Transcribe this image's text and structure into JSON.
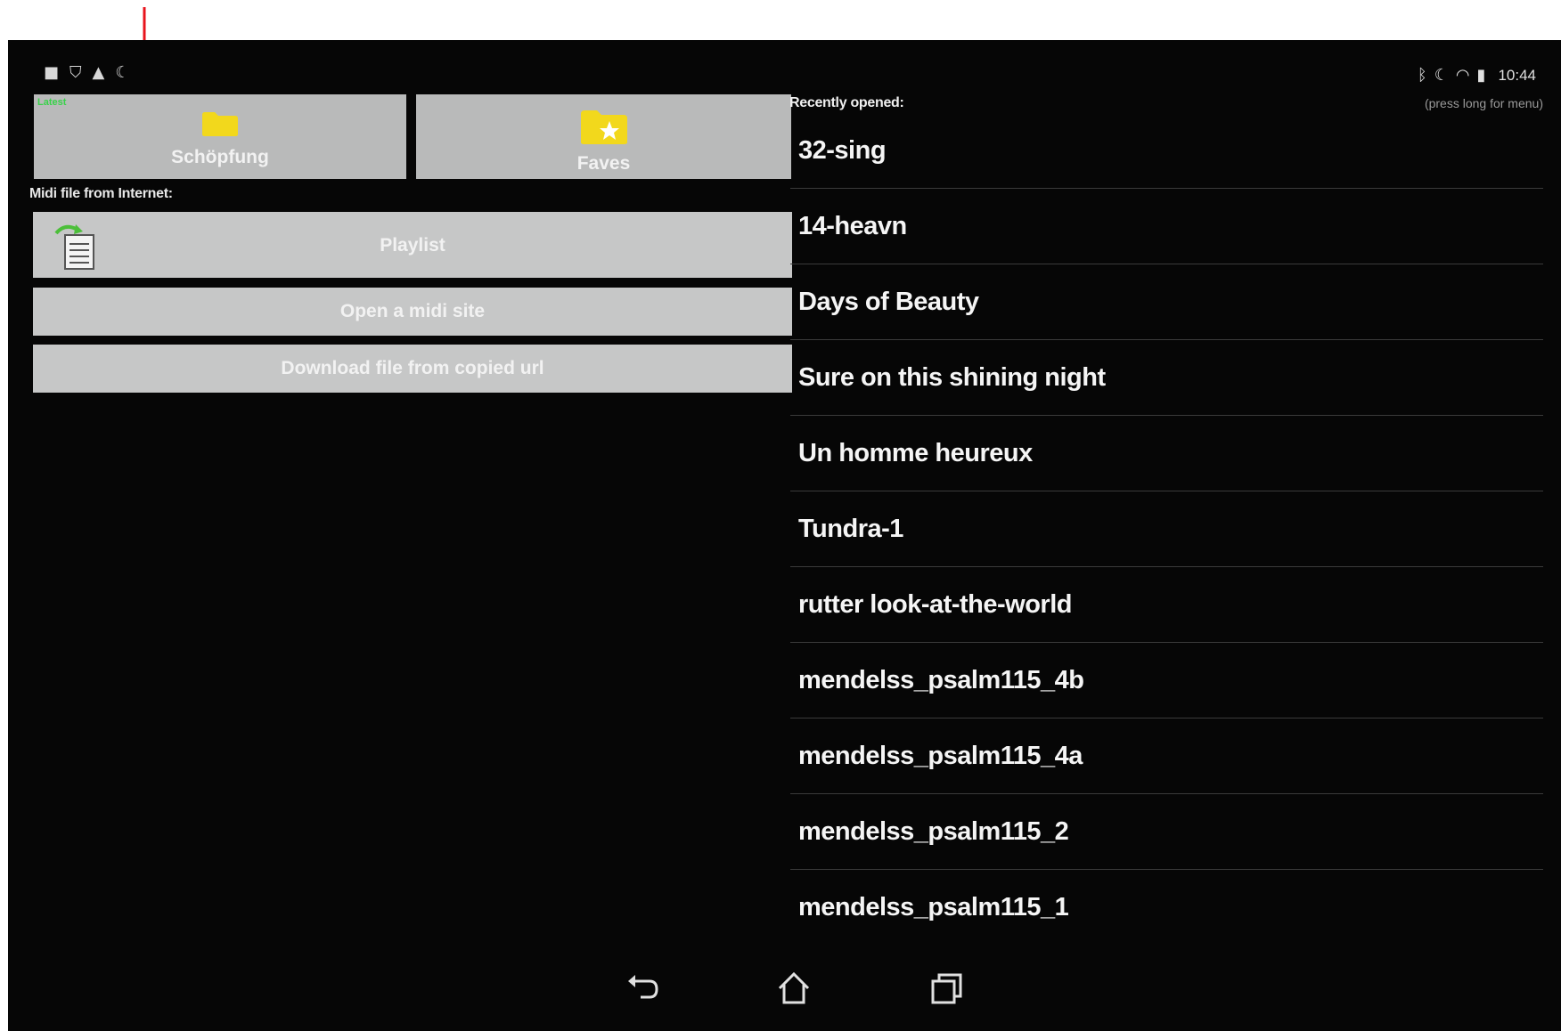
{
  "status_bar": {
    "left_icons": [
      "notification-icon",
      "shield-icon",
      "warning-icon",
      "moon-icon"
    ],
    "right_icons": [
      "bluetooth-icon",
      "moon-icon",
      "wifi-icon",
      "battery-icon"
    ],
    "time": "10:44"
  },
  "hint": "(press long for menu)",
  "folder_button": {
    "tag": "Latest",
    "label": "Schöpfung",
    "icon": "folder-icon"
  },
  "faves_button": {
    "label": "Faves",
    "icon": "folder-star-icon"
  },
  "internet_section_label": "Midi file from Internet:",
  "playlist_button": {
    "label": "Playlist",
    "icon": "playlist-icon"
  },
  "midi_site_button": {
    "label": "Open a midi site"
  },
  "download_button": {
    "label": "Download file from copied url"
  },
  "recent": {
    "title": "Recently opened:",
    "items": [
      "32-sing",
      "14-heavn",
      "Days of Beauty",
      "Sure on this shining night",
      "Un homme heureux",
      "Tundra-1",
      "rutter look-at-the-world",
      "mendelss_psalm115_4b",
      "mendelss_psalm115_4a",
      "mendelss_psalm115_2",
      "mendelss_psalm115_1"
    ]
  },
  "navbar": {
    "icons": [
      "back-icon",
      "home-icon",
      "recents-icon"
    ]
  },
  "colors": {
    "background": "#060606",
    "button": "#b9baba",
    "annotation_arrow": "#e8141c",
    "folder_yellow": "#f2d81c",
    "tag_green": "#39d24a"
  }
}
